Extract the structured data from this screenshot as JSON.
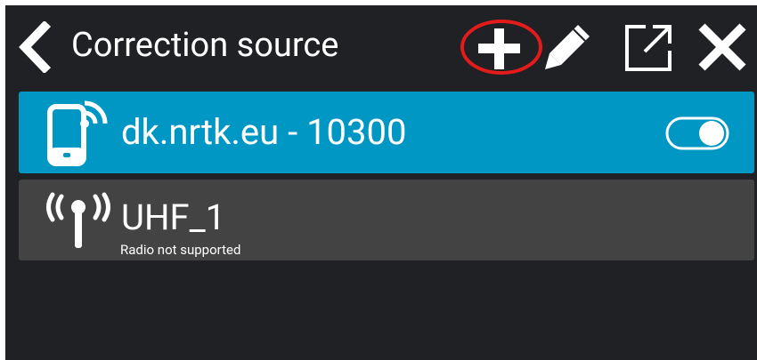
{
  "header": {
    "title": "Correction source",
    "back_icon": "chevron-left-icon",
    "actions": [
      {
        "name": "add",
        "icon": "plus-icon",
        "highlighted": true
      },
      {
        "name": "edit",
        "icon": "pencil-icon"
      },
      {
        "name": "share",
        "icon": "external-link-icon"
      },
      {
        "name": "close",
        "icon": "close-icon"
      }
    ]
  },
  "sources": [
    {
      "label": "dk.nrtk.eu - 10300",
      "icon": "mobile-signal-icon",
      "active": true,
      "enabled": true
    },
    {
      "label": "UHF_1",
      "sublabel": "Radio not supported",
      "icon": "radio-antenna-icon",
      "active": false
    }
  ],
  "colors": {
    "background": "#1f2124",
    "active_item": "#0197c5",
    "inactive_item": "#434343",
    "text": "#ffffff",
    "highlight_circle": "#e31b1b"
  }
}
